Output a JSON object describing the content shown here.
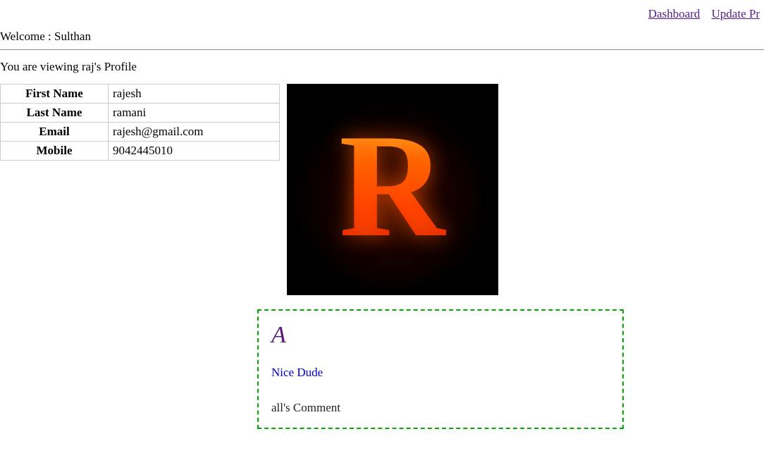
{
  "nav": {
    "dashboard": "Dashboard",
    "update_profile": "Update Pr"
  },
  "welcome_label": "Welcome : ",
  "welcome_user": "Sulthan",
  "viewing_text": "You are viewing raj's Profile",
  "profile": {
    "headers": {
      "first_name": "First Name",
      "last_name": "Last Name",
      "email": "Email",
      "mobile": "Mobile"
    },
    "values": {
      "first_name": "rajesh",
      "last_name": "ramani",
      "email": "rajesh@gmail.com",
      "mobile": "9042445010"
    }
  },
  "avatar_letter": "R",
  "comment": {
    "icon_letter": "A",
    "text": "Nice Dude",
    "by": "all's Comment"
  }
}
